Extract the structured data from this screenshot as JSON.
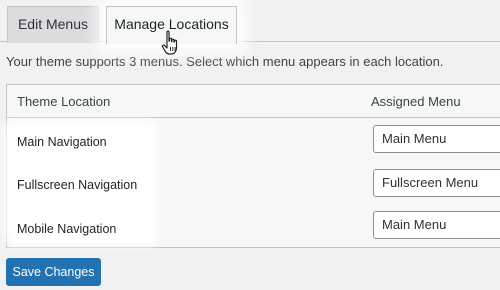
{
  "tabs": {
    "edit_menus": "Edit Menus",
    "manage_locations": "Manage Locations"
  },
  "description": "Your theme supports 3 menus. Select which menu appears in each location.",
  "table": {
    "col_location": "Theme Location",
    "col_assigned": "Assigned Menu",
    "rows": [
      {
        "location": "Main Navigation",
        "menu": "Main Menu"
      },
      {
        "location": "Fullscreen Navigation",
        "menu": "Fullscreen Menu"
      },
      {
        "location": "Mobile Navigation",
        "menu": "Main Menu"
      }
    ]
  },
  "save_button": "Save Changes",
  "colors": {
    "primary": "#2271b1",
    "background": "#f1f1f1",
    "border": "#c3c4c7"
  }
}
